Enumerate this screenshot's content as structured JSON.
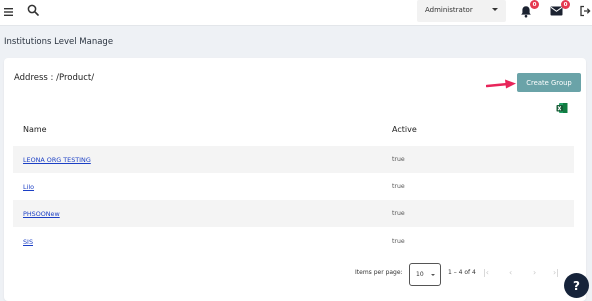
{
  "header": {
    "role_select": "Administrator",
    "notifications_count": "0",
    "messages_count": "0"
  },
  "page": {
    "title": "Institutions Level Manage"
  },
  "card": {
    "address": "Address : /Product/",
    "create_button": "Create Group",
    "columns": {
      "name": "Name",
      "active": "Active"
    },
    "rows": [
      {
        "name": "LEONA ORG TESTING",
        "active": "true"
      },
      {
        "name": "Lilo",
        "active": "true"
      },
      {
        "name": "PHSOONew",
        "active": "true"
      },
      {
        "name": "SIS",
        "active": "true"
      }
    ]
  },
  "paginator": {
    "label": "Items per page:",
    "page_size": "10",
    "range": "1 – 4 of 4"
  },
  "icons": {
    "menu": "hamburger-icon",
    "search": "search-icon",
    "bell": "bell-icon",
    "mail": "mail-icon",
    "logout": "logout-icon",
    "excel": "excel-icon",
    "help": "help-icon"
  },
  "colors": {
    "create_button": "#6aa3a8",
    "arrow": "#e8255a",
    "badge": "#e53950",
    "link": "#1b3fc5",
    "help_button": "#16233a"
  }
}
